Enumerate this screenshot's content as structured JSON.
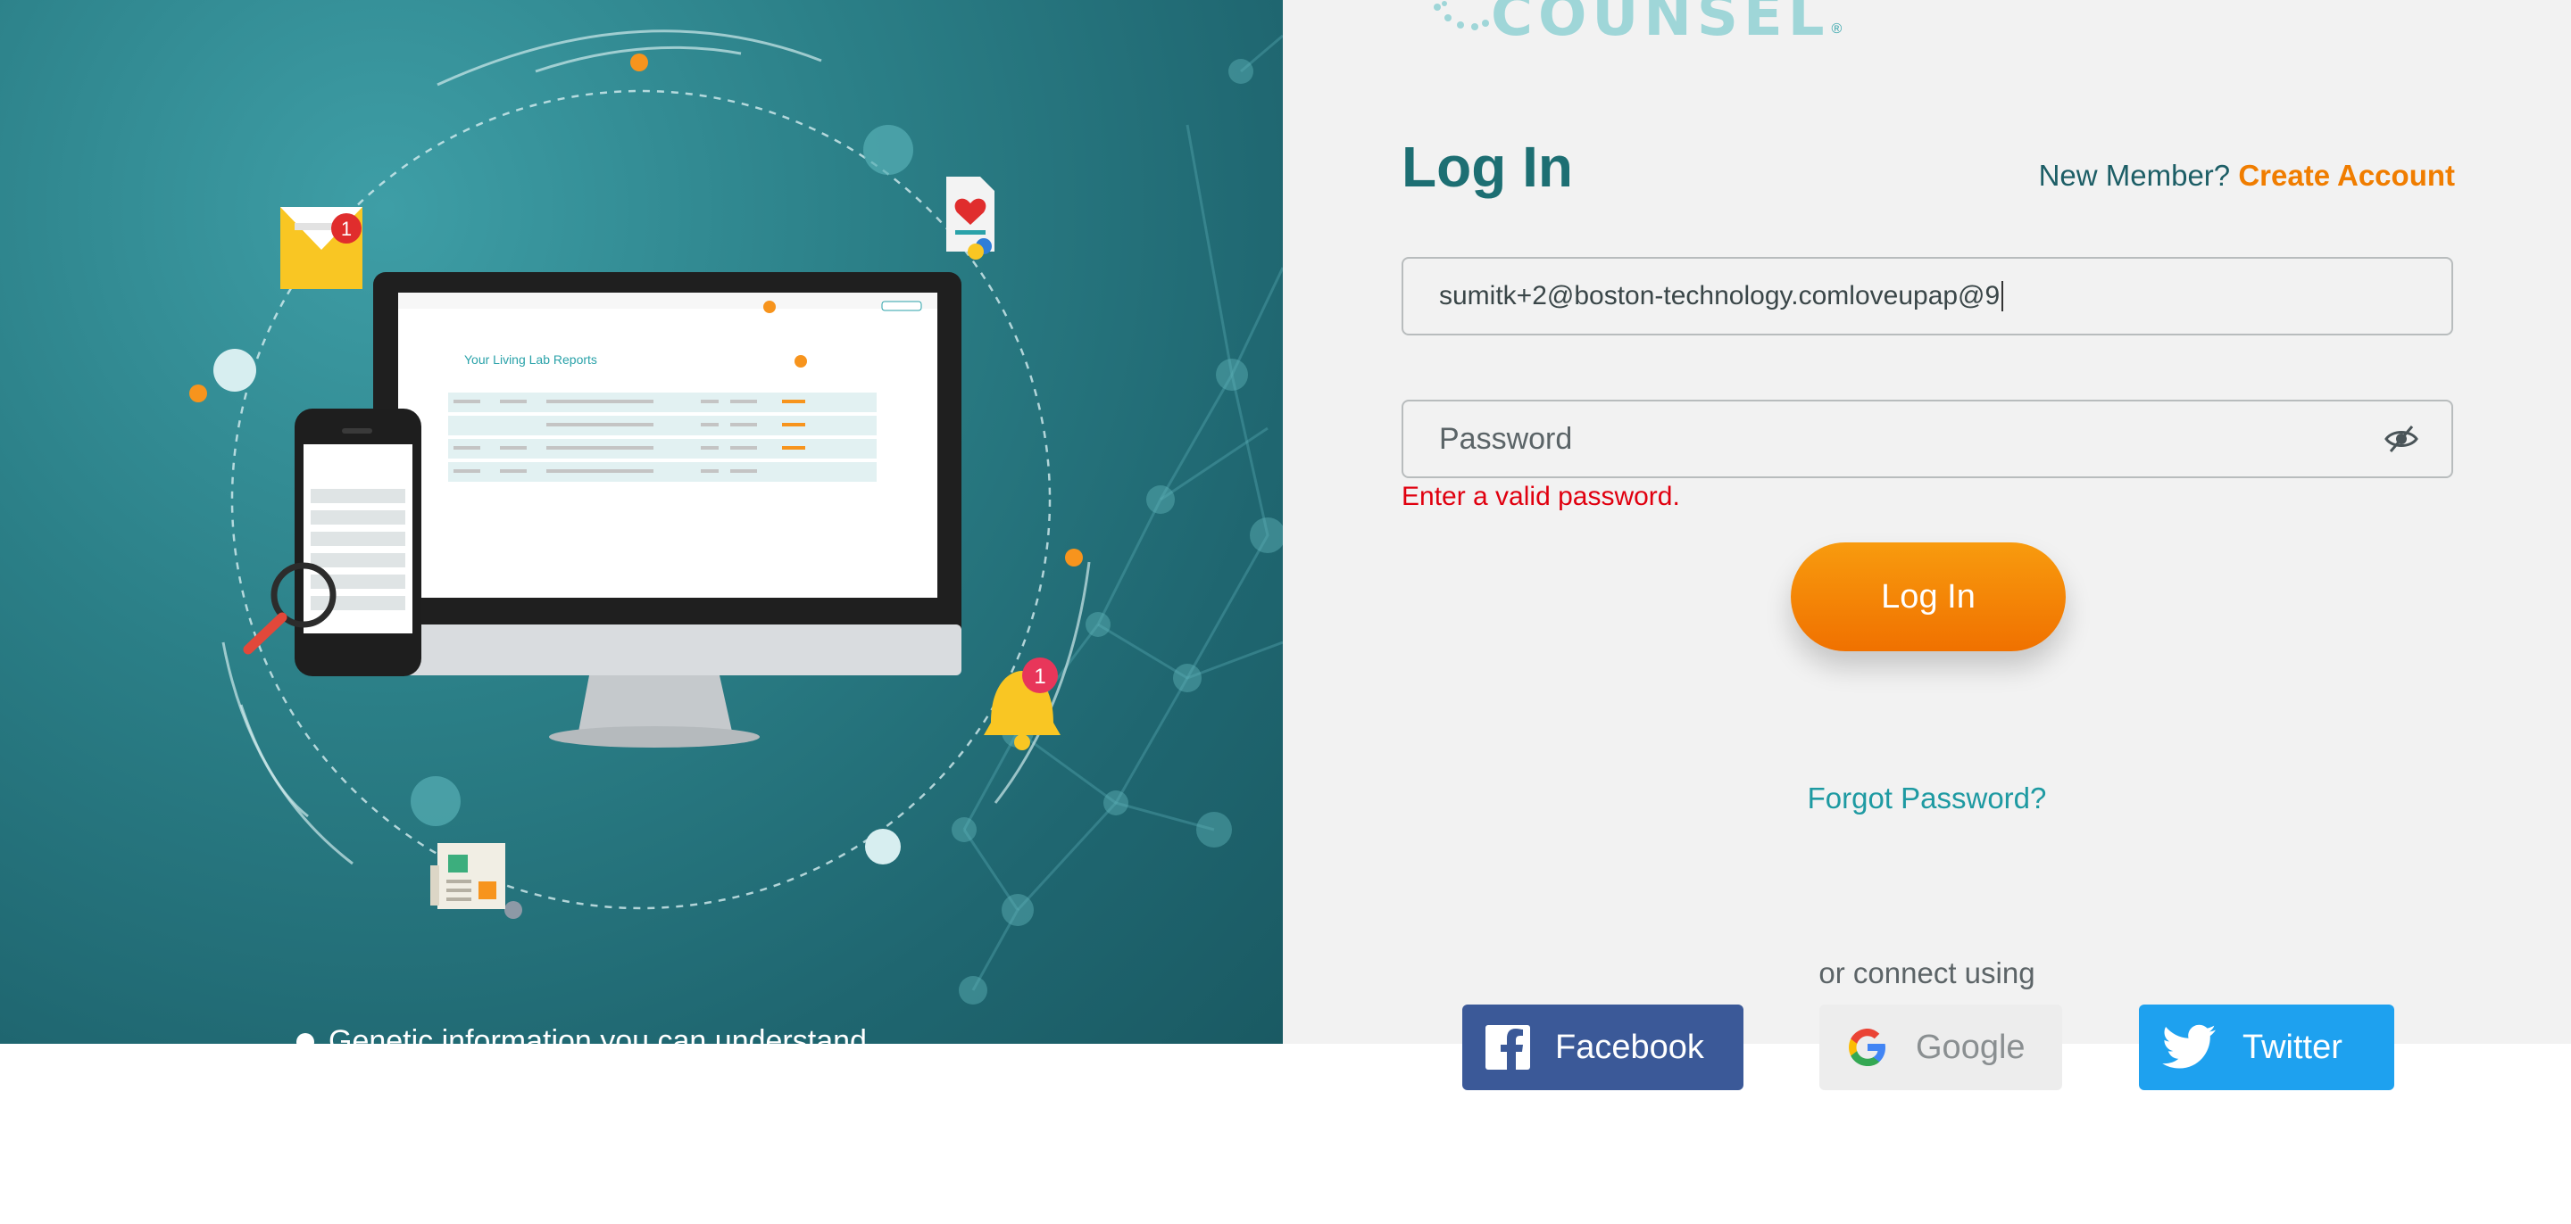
{
  "brand": {
    "logo_text": "COUNSEL",
    "logo_mark": "®"
  },
  "hero": {
    "caption": "Genetic information you can understand",
    "screen": {
      "report_title": "Your Living Lab Reports",
      "notification_count": "1",
      "email_count": "1"
    }
  },
  "login": {
    "title": "Log In",
    "new_member_text": "New Member?",
    "create_account_link": "Create Account",
    "email_value": "sumitk+2@boston-technology.comloveupap@9",
    "password_placeholder": "Password",
    "error_text": "Enter a valid password.",
    "submit_label": "Log In",
    "forgot_password_link": "Forgot Password?",
    "or_connect_text": "or connect using"
  },
  "social": {
    "facebook_label": "Facebook",
    "google_label": "Google",
    "twitter_label": "Twitter"
  },
  "colors": {
    "accent_orange": "#f07d00",
    "teal_title": "#1d6f73",
    "error_red": "#e0000f",
    "facebook_blue": "#3b5998",
    "twitter_blue": "#1ea1ef"
  },
  "icons": [
    "eye-slash-icon",
    "facebook-icon",
    "google-icon",
    "twitter-icon",
    "envelope-icon",
    "bell-icon",
    "magnifier-icon",
    "document-icon",
    "newspaper-icon"
  ]
}
